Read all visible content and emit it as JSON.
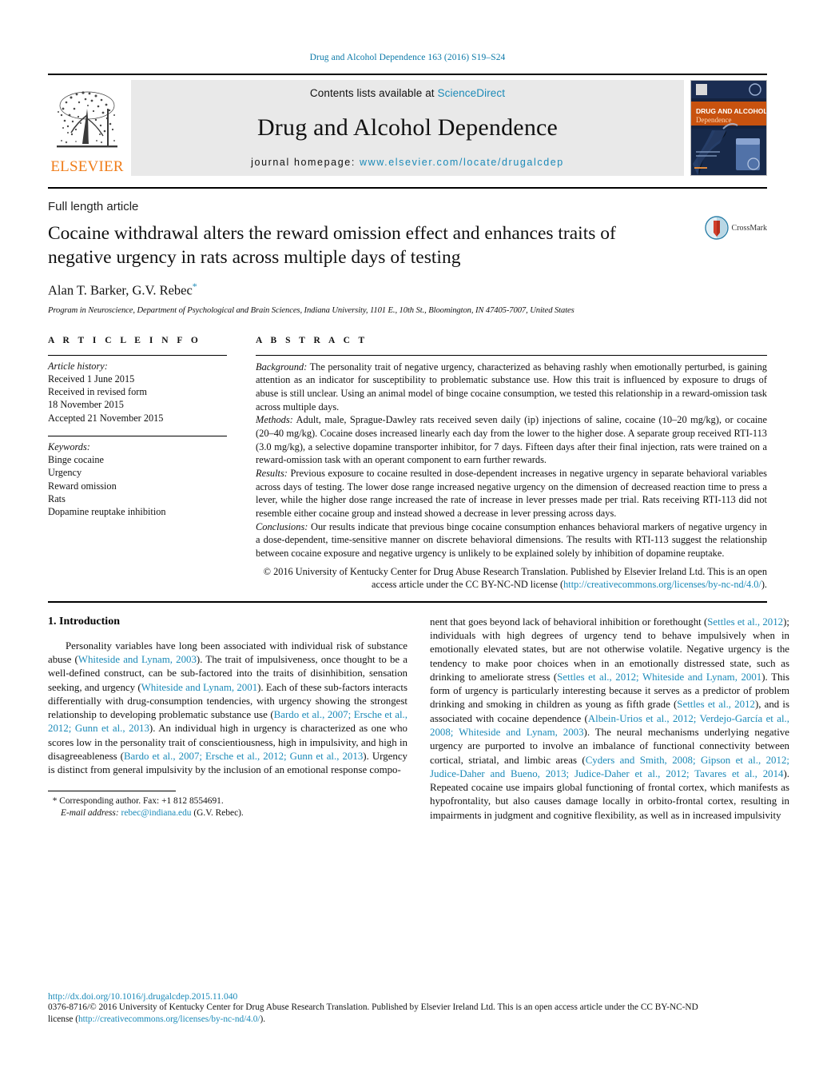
{
  "running_head": "Drug and Alcohol Dependence 163 (2016) S19–S24",
  "masthead": {
    "contents_prefix": "Contents lists available at ",
    "sciencedirect": "ScienceDirect",
    "journal_title": "Drug and Alcohol Dependence",
    "homepage_prefix": "journal homepage: ",
    "homepage_url": "www.elsevier.com/locate/drugalcdep",
    "publisher_name": "ELSEVIER",
    "publisher_logo": "elsevier-tree-logo",
    "cover_title_line1": "DRUG AND ALCOHOL",
    "cover_title_line2": "Dependence"
  },
  "title_block": {
    "article_type": "Full length article",
    "title": "Cocaine withdrawal alters the reward omission effect and enhances traits of negative urgency in rats across multiple days of testing",
    "authors": "Alan T. Barker, G.V. Rebec",
    "corresponding_marker": "*",
    "affiliation": "Program in Neuroscience, Department of Psychological and Brain Sciences, Indiana University, 1101 E., 10th St., Bloomington, IN 47405-7007, United States",
    "crossmark_label": "CrossMark"
  },
  "article_info": {
    "heading": "A R T I C L E    I N F O",
    "history_label": "Article history:",
    "history": [
      "Received 1 June 2015",
      "Received in revised form",
      "18 November 2015",
      "Accepted 21 November 2015"
    ],
    "keywords_label": "Keywords:",
    "keywords": [
      "Binge cocaine",
      "Urgency",
      "Reward omission",
      "Rats",
      "Dopamine reuptake inhibition"
    ]
  },
  "abstract": {
    "heading": "A B S T R A C T",
    "background_label": "Background:",
    "background": " The personality trait of negative urgency, characterized as behaving rashly when emotionally perturbed, is gaining attention as an indicator for susceptibility to problematic substance use. How this trait is influenced by exposure to drugs of abuse is still unclear. Using an animal model of binge cocaine consumption, we tested this relationship in a reward-omission task across multiple days.",
    "methods_label": "Methods:",
    "methods": " Adult, male, Sprague-Dawley rats received seven daily (ip) injections of saline, cocaine (10–20 mg/kg), or cocaine (20–40 mg/kg). Cocaine doses increased linearly each day from the lower to the higher dose. A separate group received RTI-113 (3.0 mg/kg), a selective dopamine transporter inhibitor, for 7 days. Fifteen days after their final injection, rats were trained on a reward-omission task with an operant component to earn further rewards.",
    "results_label": "Results:",
    "results": " Previous exposure to cocaine resulted in dose-dependent increases in negative urgency in separate behavioral variables across days of testing. The lower dose range increased negative urgency on the dimension of decreased reaction time to press a lever, while the higher dose range increased the rate of increase in lever presses made per trial. Rats receiving RTI-113 did not resemble either cocaine group and instead showed a decrease in lever pressing across days.",
    "conclusions_label": "Conclusions:",
    "conclusions": " Our results indicate that previous binge cocaine consumption enhances behavioral markers of negative urgency in a dose-dependent, time-sensitive manner on discrete behavioral dimensions. The results with RTI-113 suggest the relationship between cocaine exposure and negative urgency is unlikely to be explained solely by inhibition of dopamine reuptake.",
    "copyright": "© 2016 University of Kentucky Center for Drug Abuse Research Translation. Published by Elsevier Ireland Ltd. This is an open access article under the CC BY-NC-ND license",
    "license_open_paren": "(",
    "license_url": "http://creativecommons.org/licenses/by-nc-nd/4.0/",
    "license_close_paren": ")."
  },
  "introduction": {
    "heading": "1.  Introduction",
    "left_col": [
      {
        "t": "Personality variables have long been associated with individual risk of substance abuse ("
      },
      {
        "t": "Whiteside and Lynam, 2003",
        "link": true
      },
      {
        "t": "). The trait of impulsiveness, once thought to be a well-defined construct, can be sub-factored into the traits of disinhibition, sensation seeking, and urgency ("
      },
      {
        "t": "Whiteside and Lynam, 2001",
        "link": true
      },
      {
        "t": "). Each of these sub-factors interacts differentially with drug-consumption tendencies, with urgency showing the strongest relationship to developing problematic substance use ("
      },
      {
        "t": "Bardo et al., 2007; Ersche et al., 2012; Gunn et al., 2013",
        "link": true
      },
      {
        "t": "). An individual high in urgency is characterized as one who scores low in the personality trait of conscientiousness, high in impulsivity, and high in disagreeableness ("
      },
      {
        "t": "Bardo et al., 2007; Ersche et al., 2012; Gunn et al., 2013",
        "link": true
      },
      {
        "t": "). Urgency is distinct from general impulsivity by the inclusion of an emotional response compo-"
      }
    ],
    "right_col": [
      {
        "t": "nent that goes beyond lack of behavioral inhibition or forethought ("
      },
      {
        "t": "Settles et al., 2012",
        "link": true
      },
      {
        "t": "); individuals with high degrees of urgency tend to behave impulsively when in emotionally elevated states, but are not otherwise volatile. Negative urgency is the tendency to make poor choices when in an emotionally distressed state, such as drinking to ameliorate stress ("
      },
      {
        "t": "Settles et al., 2012; Whiteside and Lynam, 2001",
        "link": true
      },
      {
        "t": "). This form of urgency is particularly interesting because it serves as a predictor of problem drinking and smoking in children as young as fifth grade ("
      },
      {
        "t": "Settles et al., 2012",
        "link": true
      },
      {
        "t": "), and is associated with cocaine dependence ("
      },
      {
        "t": "Albein-Urios et al., 2012; Verdejo-García et al., 2008; Whiteside and Lynam, 2003",
        "link": true
      },
      {
        "t": "). The neural mechanisms underlying negative urgency are purported to involve an imbalance of functional connectivity between cortical, striatal, and limbic areas ("
      },
      {
        "t": "Cyders and Smith, 2008; Gipson et al., 2012; Judice-Daher and Bueno, 2013; Judice-Daher et al., 2012; Tavares et al., 2014",
        "link": true
      },
      {
        "t": "). Repeated cocaine use impairs global functioning of frontal cortex, which manifests as hypofrontality, but also causes damage locally in orbito-frontal cortex, resulting in impairments in judgment and cognitive flexibility, as well as in increased impulsivity"
      }
    ]
  },
  "footnote": {
    "marker": "*",
    "corresponding": " Corresponding author. Fax: +1 812 8554691.",
    "email_label": "E-mail address:",
    "email": "rebec@indiana.edu",
    "email_suffix": " (G.V. Rebec)."
  },
  "footer": {
    "doi": "http://dx.doi.org/10.1016/j.drugalcdep.2015.11.040",
    "issn_line1": "0376-8716/© 2016 University of Kentucky Center for Drug Abuse Research Translation. Published by Elsevier Ireland Ltd. This is an open access article under the CC BY-NC-ND",
    "issn_license_prefix": "license (",
    "issn_license_url": "http://creativecommons.org/licenses/by-nc-nd/4.0/",
    "issn_license_suffix": ")."
  },
  "colors": {
    "link": "#1b8ab8",
    "elsevier_orange": "#f07d1a",
    "journal_box_bg": "#e9e9e9"
  }
}
